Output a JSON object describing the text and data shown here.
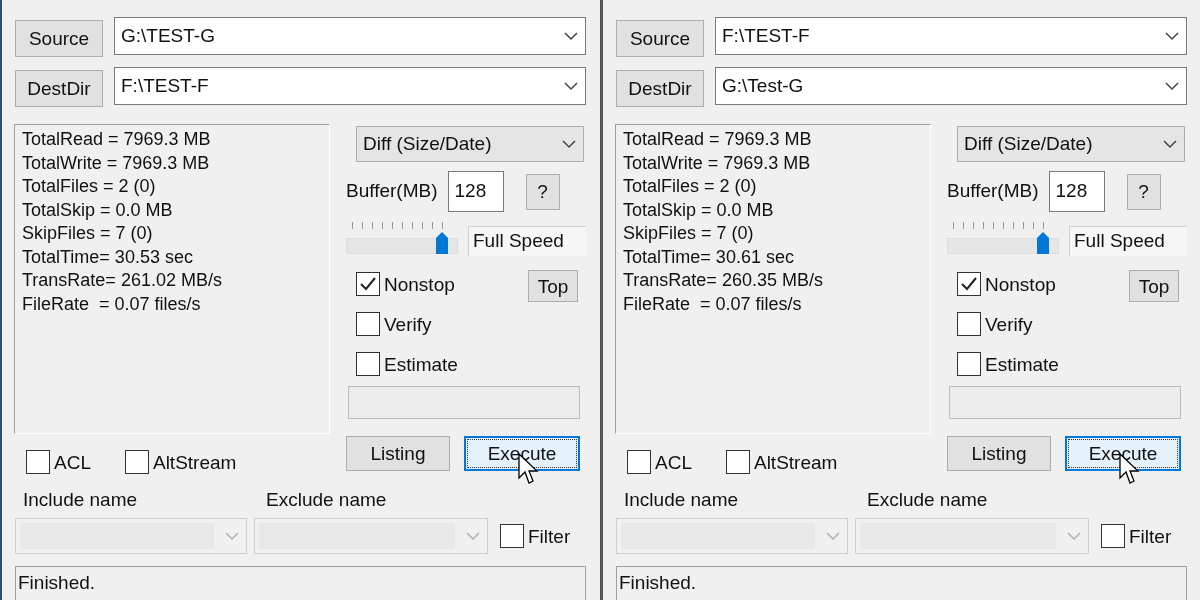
{
  "windows": [
    {
      "source_button": "Source",
      "source_path": "G:\\TEST-G",
      "destdir_button": "DestDir",
      "dest_path": "F:\\TEST-F",
      "stats": [
        "TotalRead = 7969.3 MB",
        "TotalWrite = 7969.3 MB",
        "TotalFiles = 2 (0)",
        "TotalSkip = 0.0 MB",
        "SkipFiles = 7 (0)",
        "TotalTime= 30.53 sec",
        "TransRate= 261.02 MB/s",
        "FileRate  = 0.07 files/s"
      ],
      "mode": "Diff (Size/Date)",
      "buffer_label": "Buffer(MB)",
      "buffer_value": "128",
      "help_button": "?",
      "speed": {
        "level": 0.9,
        "label": "Full Speed"
      },
      "options": [
        {
          "label": "Nonstop",
          "checked": true
        },
        {
          "label": "Verify",
          "checked": false
        },
        {
          "label": "Estimate",
          "checked": false
        }
      ],
      "top_button": "Top",
      "progress": {
        "level": 0
      },
      "listing_button": "Listing",
      "execute_button": {
        "label": "Execute",
        "focused": true
      },
      "bottom_options": [
        {
          "label": "ACL",
          "checked": false
        },
        {
          "label": "AltStream",
          "checked": false
        }
      ],
      "include_label": "Include name",
      "exclude_label": "Exclude name",
      "include_field": {
        "disabled": true
      },
      "exclude_field": {
        "disabled": true
      },
      "filter": {
        "label": "Filter",
        "checked": false
      },
      "status": "Finished."
    },
    {
      "source_button": "Source",
      "source_path": "F:\\TEST-F",
      "destdir_button": "DestDir",
      "dest_path": "G:\\Test-G",
      "stats": [
        "TotalRead = 7969.3 MB",
        "TotalWrite = 7969.3 MB",
        "TotalFiles = 2 (0)",
        "TotalSkip = 0.0 MB",
        "SkipFiles = 7 (0)",
        "TotalTime= 30.61 sec",
        "TransRate= 260.35 MB/s",
        "FileRate  = 0.07 files/s"
      ],
      "mode": "Diff (Size/Date)",
      "buffer_label": "Buffer(MB)",
      "buffer_value": "128",
      "help_button": "?",
      "speed": {
        "level": 0.9,
        "label": "Full Speed"
      },
      "options": [
        {
          "label": "Nonstop",
          "checked": true
        },
        {
          "label": "Verify",
          "checked": false
        },
        {
          "label": "Estimate",
          "checked": false
        }
      ],
      "top_button": "Top",
      "progress": {
        "level": 0
      },
      "listing_button": "Listing",
      "execute_button": {
        "label": "Execute",
        "focused": true
      },
      "bottom_options": [
        {
          "label": "ACL",
          "checked": false
        },
        {
          "label": "AltStream",
          "checked": false
        }
      ],
      "include_label": "Include name",
      "exclude_label": "Exclude name",
      "include_field": {
        "disabled": true
      },
      "exclude_field": {
        "disabled": true
      },
      "filter": {
        "label": "Filter",
        "checked": false
      },
      "status": "Finished."
    }
  ]
}
